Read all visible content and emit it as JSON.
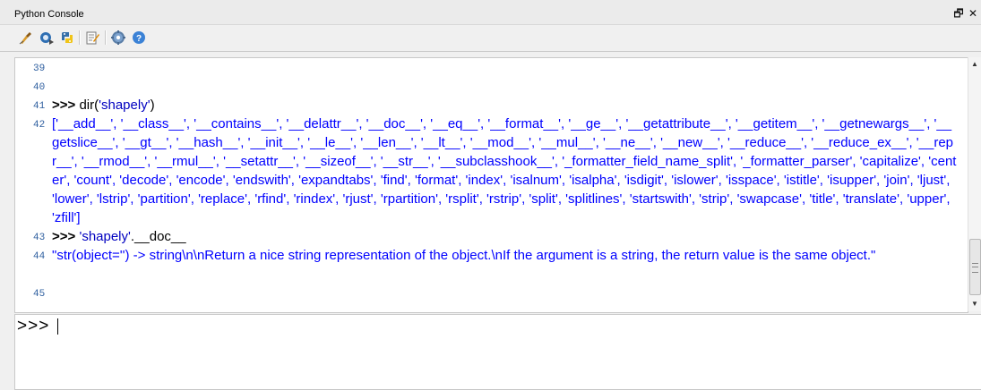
{
  "window": {
    "title": "Python Console",
    "restore_glyph": "🗗",
    "close_glyph": "✕"
  },
  "toolbar": {
    "tools": [
      "clear-console-icon",
      "run-script-icon",
      "python-icon",
      "show-editor-icon",
      "settings-icon",
      "help-icon"
    ]
  },
  "console": {
    "lines": [
      {
        "num": "39",
        "segments": []
      },
      {
        "num": "40",
        "segments": []
      },
      {
        "num": "41",
        "segments": [
          {
            "cls": "prompt",
            "text": ">>> "
          },
          {
            "cls": "cmd",
            "text": "dir("
          },
          {
            "cls": "str",
            "text": "'shapely'"
          },
          {
            "cls": "cmd",
            "text": ")"
          }
        ]
      },
      {
        "num": "42",
        "segments": [
          {
            "cls": "out",
            "text": "['__add__', '__class__', '__contains__', '__delattr__', '__doc__', '__eq__', '__format__', '__ge__', '__getattribute__', '__getitem__', '__getnewargs__', '__getslice__', '__gt__', '__hash__', '__init__', '__le__', '__len__', '__lt__', '__mod__', '__mul__', '__ne__', '__new__', '__reduce__', '__reduce_ex__', '__repr__', '__rmod__', '__rmul__', '__setattr__', '__sizeof__', '__str__', '__subclasshook__', '_formatter_field_name_split', '_formatter_parser', 'capitalize', 'center', 'count', 'decode', 'encode', 'endswith', 'expandtabs', 'find', 'format', 'index', 'isalnum', 'isalpha', 'isdigit', 'islower', 'isspace', 'istitle', 'isupper', 'join', 'ljust', 'lower', 'lstrip', 'partition', 'replace', 'rfind', 'rindex', 'rjust', 'rpartition', 'rsplit', 'rstrip', 'split', 'splitlines', 'startswith', 'strip', 'swapcase', 'title', 'translate', 'upper', 'zfill']"
          }
        ]
      },
      {
        "num": "43",
        "segments": [
          {
            "cls": "prompt",
            "text": ">>> "
          },
          {
            "cls": "str",
            "text": "'shapely'"
          },
          {
            "cls": "cmd",
            "text": ".__doc__"
          }
        ]
      },
      {
        "num": "44",
        "segments": [
          {
            "cls": "out",
            "text": "\"str(object='') -> string\\n\\nReturn a nice string representation of the object.\\nIf the argument is a string, the return value is the same object.\""
          }
        ]
      },
      {
        "num": "45",
        "segments": []
      }
    ]
  },
  "input": {
    "prompt": ">>>",
    "value": ""
  },
  "colors": {
    "output": "#0000ff",
    "prompt": "#000000",
    "line_number": "#3060a0"
  }
}
